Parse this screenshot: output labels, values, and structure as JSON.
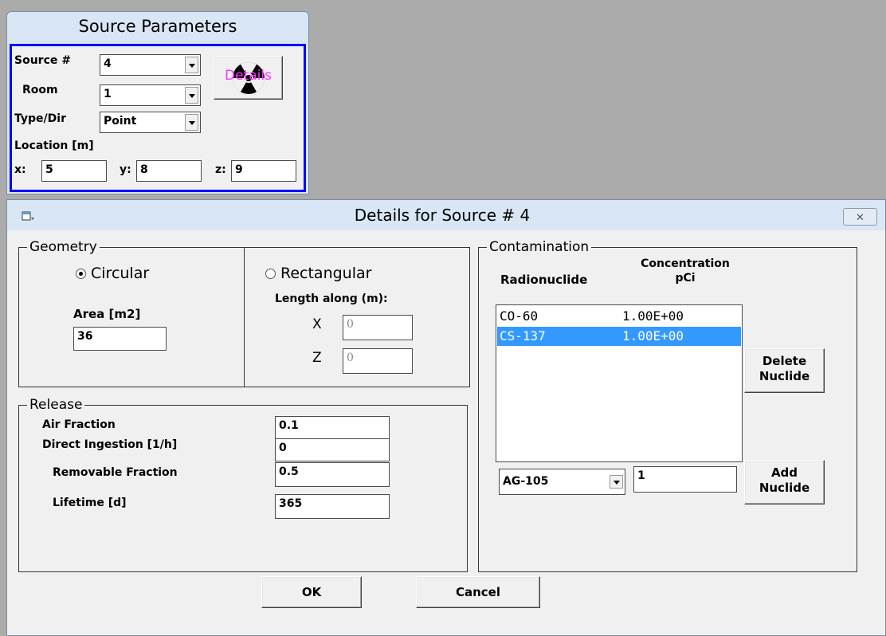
{
  "source_params": {
    "title": "Source Parameters",
    "source_label": "Source #",
    "source_value": "4",
    "room_label": "Room",
    "room_value": "1",
    "type_label": "Type/Dir",
    "type_value": "Point",
    "location_label": "Location [m]",
    "x_label": "x:",
    "x_value": "5",
    "y_label": "y:",
    "y_value": "8",
    "z_label": "z:",
    "z_value": "9",
    "details_button_label": "Details"
  },
  "dialog": {
    "title": "Details for Source #  4",
    "close_glyph": "✕",
    "geometry": {
      "legend": "Geometry",
      "circular_label": "Circular",
      "circular_selected": true,
      "rectangular_label": "Rectangular",
      "area_label": "Area [m2]",
      "area_value": "36",
      "length_label": "Length along (m):",
      "x_label": "X",
      "x_value": "0",
      "z_label": "Z",
      "z_value": "0"
    },
    "release": {
      "legend": "Release",
      "air_fraction_label": "Air Fraction",
      "air_fraction_value": "0.1",
      "direct_ingestion_label": "Direct Ingestion [1/h]",
      "direct_ingestion_value": "0",
      "removable_fraction_label": "Removable Fraction",
      "removable_fraction_value": "0.5",
      "lifetime_label": "Lifetime [d]",
      "lifetime_value": "365"
    },
    "contamination": {
      "legend": "Contamination",
      "col_radionuclide": "Radionuclide",
      "col_concentration_line1": "Concentration",
      "col_concentration_line2": "pCi",
      "rows": [
        {
          "nuclide": "CO-60",
          "conc": "1.00E+00",
          "selected": false
        },
        {
          "nuclide": "CS-137",
          "conc": "1.00E+00",
          "selected": true
        }
      ],
      "delete_line1": "Delete",
      "delete_line2": "Nuclide",
      "add_line1": "Add",
      "add_line2": "Nuclide",
      "nuclide_select_value": "AG-105",
      "add_conc_value": "1"
    },
    "ok_label": "OK",
    "cancel_label": "Cancel"
  },
  "colors": {
    "highlight": "#3399ff",
    "frame_blue": "#0000ff",
    "details_text": "#ff33ff"
  }
}
